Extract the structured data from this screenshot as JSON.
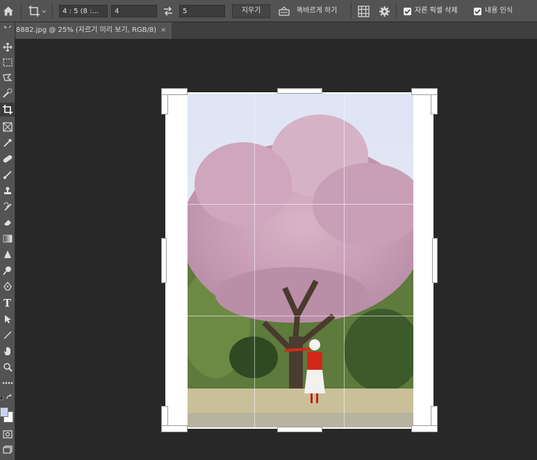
{
  "options_bar": {
    "ratio_select": "4 : 5 (8 :...",
    "width_value": "4",
    "height_value": "5",
    "clear_button": "지우기",
    "straighten_label": "똑바르게 하기",
    "delete_cropped_label": "자른 픽셀 삭제",
    "content_aware_label": "내용 인식",
    "delete_cropped_checked": true,
    "content_aware_checked": true
  },
  "document_tab": {
    "title": "8882.jpg @ 25% (자르기 미리 보기, RGB/8)",
    "close": "×"
  },
  "toolbar": {
    "active_tool": "crop-tool",
    "type_tool_glyph": "T",
    "foreground_color": "#c8d4ef",
    "background_color": "#ffffff"
  },
  "colors": {
    "ui_panel": "#535353",
    "workspace": "#282828",
    "crop_border": "#ffffff"
  }
}
